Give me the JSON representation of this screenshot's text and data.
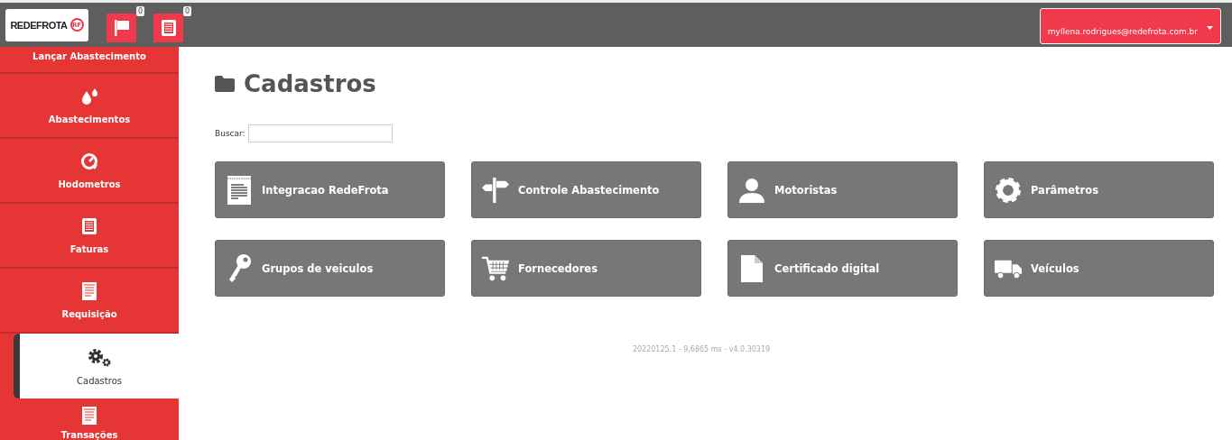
{
  "header": {
    "logo": "REDEFROTA",
    "logo_badge": "RF",
    "notifications": [
      {
        "count": "0"
      },
      {
        "count": "0"
      }
    ],
    "user_email": "myllena.rodrigues@redefrota.com.br"
  },
  "sidebar": {
    "items": [
      {
        "label": "Lançar Abastecimento",
        "selected": false
      },
      {
        "label": "Abastecimentos",
        "selected": false
      },
      {
        "label": "Hodometros",
        "selected": false
      },
      {
        "label": "Faturas",
        "selected": false
      },
      {
        "label": "Requisição",
        "selected": false
      },
      {
        "label": "Cadastros",
        "selected": true
      },
      {
        "label": "Transações",
        "selected": false
      }
    ]
  },
  "page": {
    "title": "Cadastros",
    "search": {
      "label": "Buscar:"
    },
    "tiles": [
      {
        "label": "Integracao RedeFrota"
      },
      {
        "label": "Controle Abastecimento"
      },
      {
        "label": "Motoristas"
      },
      {
        "label": "Parâmetros"
      },
      {
        "label": "Grupos de veiculos"
      },
      {
        "label": "Fornecedores"
      },
      {
        "label": "Certificado digital"
      },
      {
        "label": "Veículos"
      }
    ]
  },
  "footer": "20220125.1 - 9,6865 ms - v4.0.30319"
}
